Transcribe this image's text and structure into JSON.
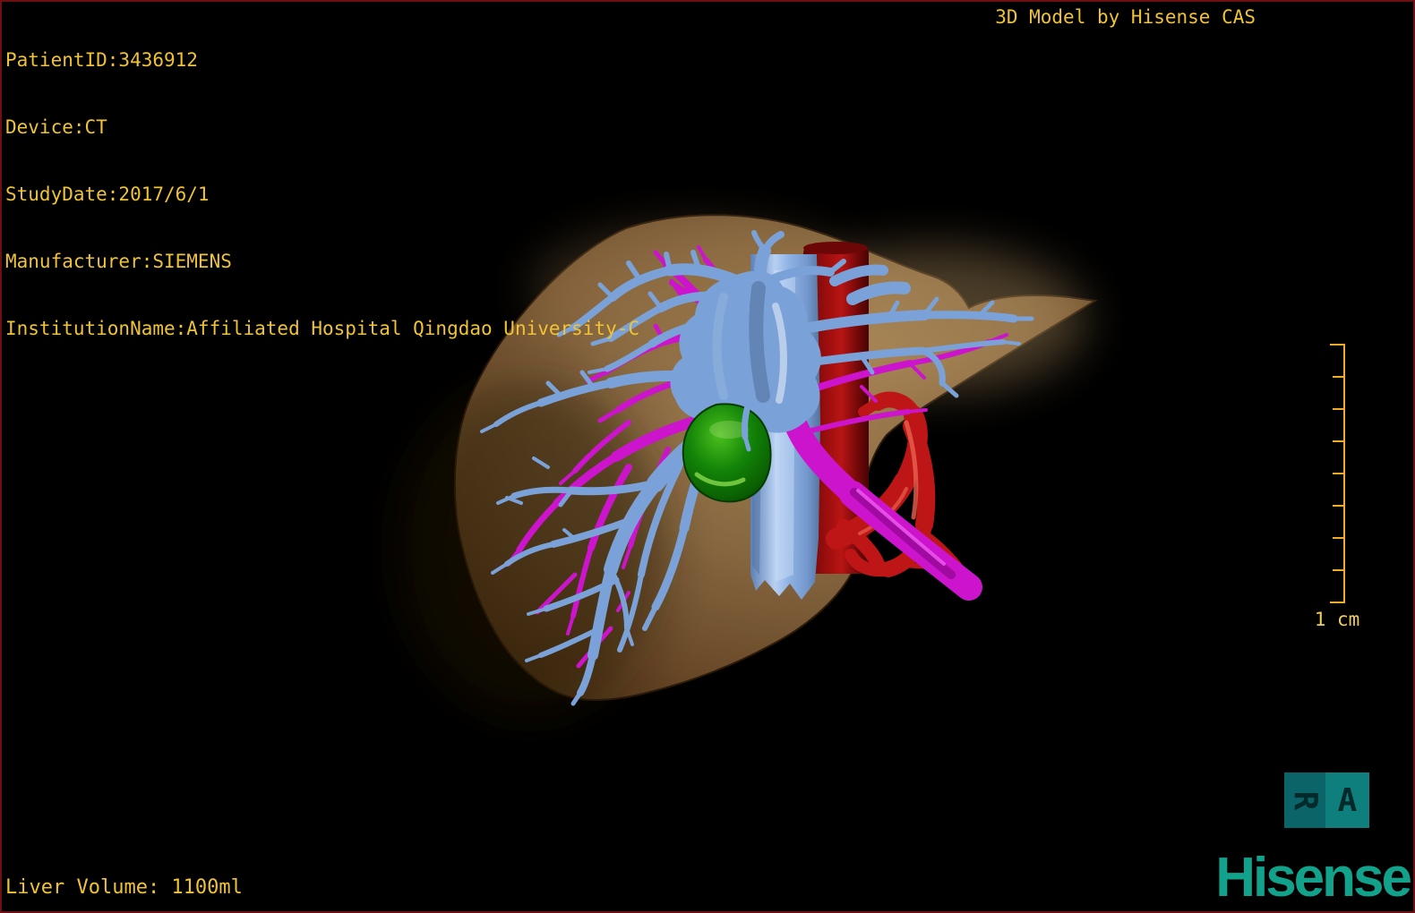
{
  "window": {
    "background": "#000000",
    "border_color": "#6E0F13"
  },
  "header": {
    "text_color": "#EFC335",
    "patient_info": [
      "PatientID:3436912",
      "Device:CT",
      "StudyDate:2017/6/1",
      "Manufacturer:SIEMENS",
      "InstitutionName:Affiliated Hospital Qingdao University-C"
    ],
    "watermark": "3D Model by Hisense CAS"
  },
  "footer": {
    "liver_volume": "Liver Volume: 1100ml"
  },
  "scale_bar": {
    "label": "1 cm",
    "divisions": 8,
    "color": "#EFAC28"
  },
  "orientation_cube": {
    "left_face": "R",
    "right_face": "A",
    "left_color": "#0A6468",
    "right_color": "#0F7F7D"
  },
  "brand": {
    "logo_text": "Hisense",
    "color": "#12A28C"
  },
  "model": {
    "structures": {
      "liver": {
        "color": "#8A6A42"
      },
      "hepatic_veins_blue": {
        "color": "#7BA2D8"
      },
      "portal_veins_magenta": {
        "color": "#CC14CC"
      },
      "ivc_light_blue": {
        "color": "#8FB2E4"
      },
      "aorta_dark_red": {
        "color": "#9B0E0E"
      },
      "hepatic_artery_red": {
        "color": "#BE1616"
      },
      "gallbladder_green": {
        "color": "#128408"
      }
    }
  }
}
